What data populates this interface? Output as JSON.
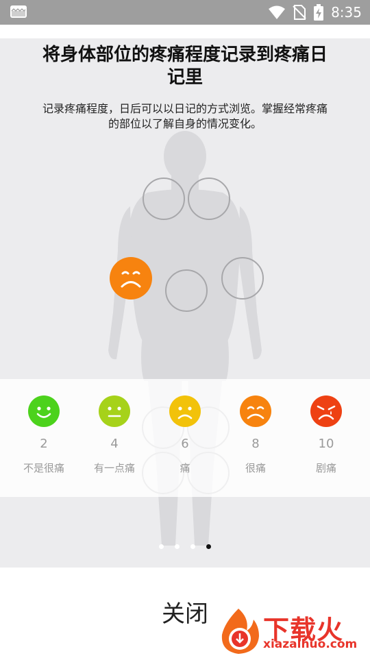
{
  "status_bar": {
    "time": "8:35"
  },
  "card": {
    "title_line1": "将身体部位的疼痛程度记录到疼痛日",
    "title_line2": "记里",
    "subtitle_line1": "记录疼痛程度，日后可以以日记的方式浏览。掌握经常疼痛",
    "subtitle_line2": "的部位以了解自身的情况变化。"
  },
  "pain_scale": [
    {
      "value": "2",
      "label": "不是很痛",
      "color": "#4cd21c",
      "expression": "smile"
    },
    {
      "value": "4",
      "label": "有一点痛",
      "color": "#a6d21a",
      "expression": "neutral"
    },
    {
      "value": "6",
      "label": "痛",
      "color": "#f2c20a",
      "expression": "frown"
    },
    {
      "value": "8",
      "label": "很痛",
      "color": "#f7830f",
      "expression": "sad"
    },
    {
      "value": "10",
      "label": "剧痛",
      "color": "#ee4113",
      "expression": "cry"
    }
  ],
  "selected_marker_color": "#f7830f",
  "pager": {
    "count": 4,
    "active_index": 3
  },
  "footer": {
    "close_label": "关闭"
  },
  "watermark": {
    "brand": "下载火",
    "url": "xiazaihuo.com"
  }
}
